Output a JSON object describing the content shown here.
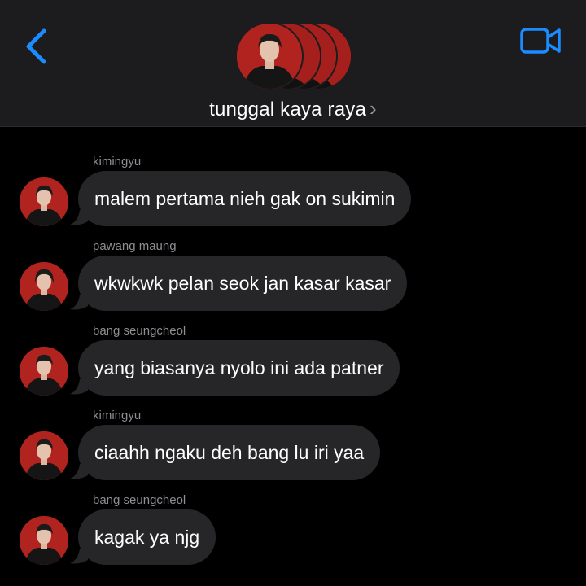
{
  "header": {
    "title": "tunggal kaya raya",
    "title_chevron": "›",
    "back_icon": "chevron-left-icon",
    "video_icon": "video-camera-icon",
    "accent_color": "#1a8cff"
  },
  "messages": [
    {
      "sender": "kimingyu",
      "text": "malem pertama nieh gak on sukimin"
    },
    {
      "sender": "pawang maung",
      "text": "wkwkwk pelan seok jan kasar kasar"
    },
    {
      "sender": "bang seungcheol",
      "text": "yang biasanya nyolo ini ada patner"
    },
    {
      "sender": "kimingyu",
      "text": "ciaahh ngaku deh bang lu iri yaa"
    },
    {
      "sender": "bang seungcheol",
      "text": "kagak ya njg"
    }
  ],
  "colors": {
    "background": "#000000",
    "header_bg": "#1c1c1e",
    "bubble_bg": "#262628",
    "sender_text": "#8e8e93",
    "avatar_bg": "#b0231f"
  }
}
